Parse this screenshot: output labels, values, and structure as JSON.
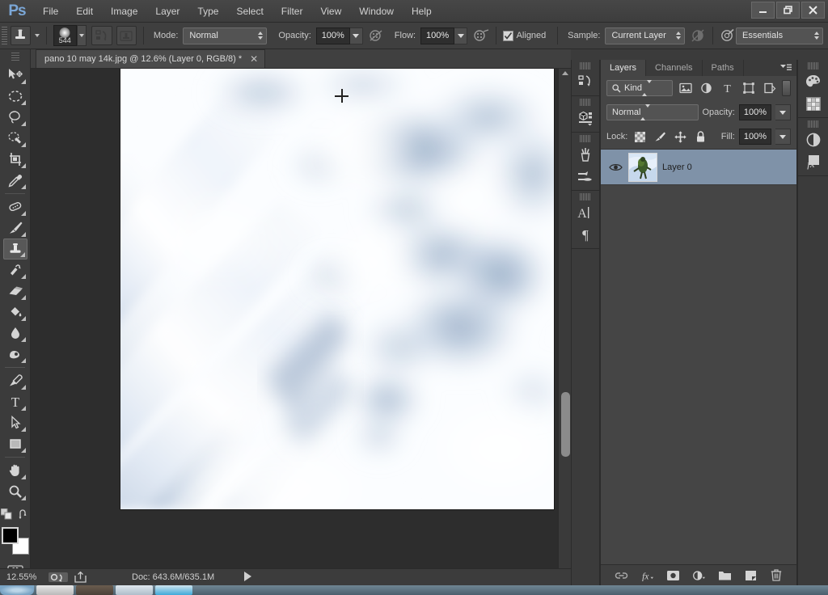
{
  "app": {
    "name": "Adobe Photoshop",
    "logo_text": "Ps"
  },
  "titlebar": {
    "menus": [
      "File",
      "Edit",
      "Image",
      "Layer",
      "Type",
      "Select",
      "Filter",
      "View",
      "Window",
      "Help"
    ],
    "window_controls": [
      "minimize-icon",
      "restore-icon",
      "close-icon"
    ]
  },
  "options_bar": {
    "tool_icon": "clone-stamp-icon",
    "brush_size": "544",
    "toggle_brush_panel": "brush-panel-icon",
    "toggle_clone_source": "clone-source-icon",
    "mode_label": "Mode:",
    "mode_value": "Normal",
    "opacity_label": "Opacity:",
    "opacity_value": "100%",
    "opacity_pressure_icon": "airbrush-pressure-icon",
    "flow_label": "Flow:",
    "flow_value": "100%",
    "airbrush_icon": "airbrush-icon",
    "aligned_label": "Aligned",
    "aligned_checked": true,
    "sample_label": "Sample:",
    "sample_value": "Current Layer",
    "ignore_adjustment_icon": "ignore-adjustment-layers-icon",
    "tablet_pressure_icon": "tablet-pressure-size-icon",
    "workspace_value": "Essentials"
  },
  "tools": [
    {
      "name": "move-tool",
      "icon": "move-icon",
      "active": false,
      "has_flyout": true
    },
    {
      "name": "marquee-tool",
      "icon": "elliptical-marquee-icon",
      "active": false,
      "has_flyout": true
    },
    {
      "name": "lasso-tool",
      "icon": "lasso-icon",
      "active": false,
      "has_flyout": true
    },
    {
      "name": "quick-selection-tool",
      "icon": "quick-selection-icon",
      "active": false,
      "has_flyout": true
    },
    {
      "name": "crop-tool",
      "icon": "crop-icon",
      "active": false,
      "has_flyout": true
    },
    {
      "name": "eyedropper-tool",
      "icon": "eyedropper-icon",
      "active": false,
      "has_flyout": true
    },
    {
      "name": "spot-healing-tool",
      "icon": "healing-brush-icon",
      "active": false,
      "has_flyout": true
    },
    {
      "name": "brush-tool",
      "icon": "brush-icon",
      "active": false,
      "has_flyout": true
    },
    {
      "name": "clone-stamp-tool",
      "icon": "clone-stamp-icon",
      "active": true,
      "has_flyout": true
    },
    {
      "name": "history-brush-tool",
      "icon": "history-brush-icon",
      "active": false,
      "has_flyout": true
    },
    {
      "name": "eraser-tool",
      "icon": "eraser-icon",
      "active": false,
      "has_flyout": true
    },
    {
      "name": "gradient-tool",
      "icon": "paint-bucket-icon",
      "active": false,
      "has_flyout": true
    },
    {
      "name": "blur-tool",
      "icon": "blur-drop-icon",
      "active": false,
      "has_flyout": true
    },
    {
      "name": "dodge-tool",
      "icon": "dodge-icon",
      "active": false,
      "has_flyout": true
    },
    {
      "name": "pen-tool",
      "icon": "pen-icon",
      "active": false,
      "has_flyout": true
    },
    {
      "name": "type-tool",
      "icon": "type-t-icon",
      "active": false,
      "has_flyout": true
    },
    {
      "name": "path-selection-tool",
      "icon": "path-selection-arrow-icon",
      "active": false,
      "has_flyout": true
    },
    {
      "name": "rectangle-tool",
      "icon": "rectangle-shape-icon",
      "active": false,
      "has_flyout": true
    },
    {
      "name": "hand-tool",
      "icon": "hand-icon",
      "active": false,
      "has_flyout": true
    },
    {
      "name": "zoom-tool",
      "icon": "zoom-magnifier-icon",
      "active": false,
      "has_flyout": true
    }
  ],
  "tool_extras": {
    "default_colors_icon": "default-colors-icon",
    "swap_colors_icon": "swap-colors-icon",
    "foreground_color": "#000000",
    "background_color": "#ffffff",
    "quick_mask_icon": "quick-mask-icon"
  },
  "document": {
    "tab_title": "pano 10 may 14k.jpg @ 12.6% (Layer 0, RGB/8) *",
    "close_icon": "close-icon",
    "cursor": "crosshair-cursor"
  },
  "status_bar": {
    "zoom": "12.55%",
    "icons": [
      "document-settings-icon",
      "share-icon"
    ],
    "doc_info": "Doc: 643.6M/635.1M",
    "play_icon": "play-arrow-icon"
  },
  "icon_dock": {
    "groups": [
      {
        "items": [
          {
            "name": "history-panel-icon",
            "label": "History"
          }
        ]
      },
      {
        "items": [
          {
            "name": "properties-panel-icon",
            "label": "Properties"
          }
        ]
      },
      {
        "items": [
          {
            "name": "brush-presets-panel-icon",
            "label": "Brush Presets"
          },
          {
            "name": "brush-panel-icon",
            "label": "Brush"
          }
        ]
      },
      {
        "items": [
          {
            "name": "character-panel-icon",
            "label": "Character"
          },
          {
            "name": "paragraph-panel-icon",
            "label": "Paragraph"
          }
        ]
      }
    ]
  },
  "icon_dock_far": {
    "groups": [
      {
        "items": [
          {
            "name": "color-panel-icon",
            "label": "Color"
          },
          {
            "name": "swatches-panel-icon",
            "label": "Swatches"
          }
        ]
      },
      {
        "items": [
          {
            "name": "adjustments-panel-icon",
            "label": "Adjustments"
          },
          {
            "name": "styles-panel-icon",
            "label": "Styles"
          }
        ]
      }
    ]
  },
  "layers_panel": {
    "tabs": [
      {
        "label": "Layers",
        "active": true
      },
      {
        "label": "Channels",
        "active": false
      },
      {
        "label": "Paths",
        "active": false
      }
    ],
    "menu_icon": "panel-menu-icon",
    "filter_kind_value": "Kind",
    "filter_icons": [
      "filter-pixel-icon",
      "filter-adjustment-icon",
      "filter-type-icon",
      "filter-shape-icon",
      "filter-smart-object-icon"
    ],
    "blend_mode": "Normal",
    "opacity_label": "Opacity:",
    "opacity_value": "100%",
    "lock_label": "Lock:",
    "lock_icons": [
      "lock-transparency-icon",
      "lock-image-pixels-icon",
      "lock-position-icon",
      "lock-all-icon"
    ],
    "fill_label": "Fill:",
    "fill_value": "100%",
    "layers": [
      {
        "name": "Layer 0",
        "visible": true,
        "selected": true,
        "visibility_icon": "eye-icon",
        "thumbnail": "layer-thumbnail"
      }
    ],
    "bottom_buttons": [
      {
        "name": "link-layers-button",
        "icon": "link-icon"
      },
      {
        "name": "layer-style-button",
        "icon": "fx-icon"
      },
      {
        "name": "layer-mask-button",
        "icon": "mask-icon"
      },
      {
        "name": "adjustment-layer-button",
        "icon": "adjustment-half-circle-icon"
      },
      {
        "name": "new-group-button",
        "icon": "folder-icon"
      },
      {
        "name": "new-layer-button",
        "icon": "new-layer-icon"
      },
      {
        "name": "delete-layer-button",
        "icon": "trash-icon"
      }
    ]
  },
  "taskbar": {
    "start_icon": "start-orb-icon",
    "items": [
      "task-app-1",
      "task-app-2",
      "task-app-3",
      "task-app-4"
    ]
  },
  "colors": {
    "chrome_bg": "#3b3b3b",
    "panel_bg": "#454545",
    "canvas_bg": "#2d2d2d",
    "selected_layer": "#7f92a8",
    "accent_logo": "#7ba7d7"
  }
}
